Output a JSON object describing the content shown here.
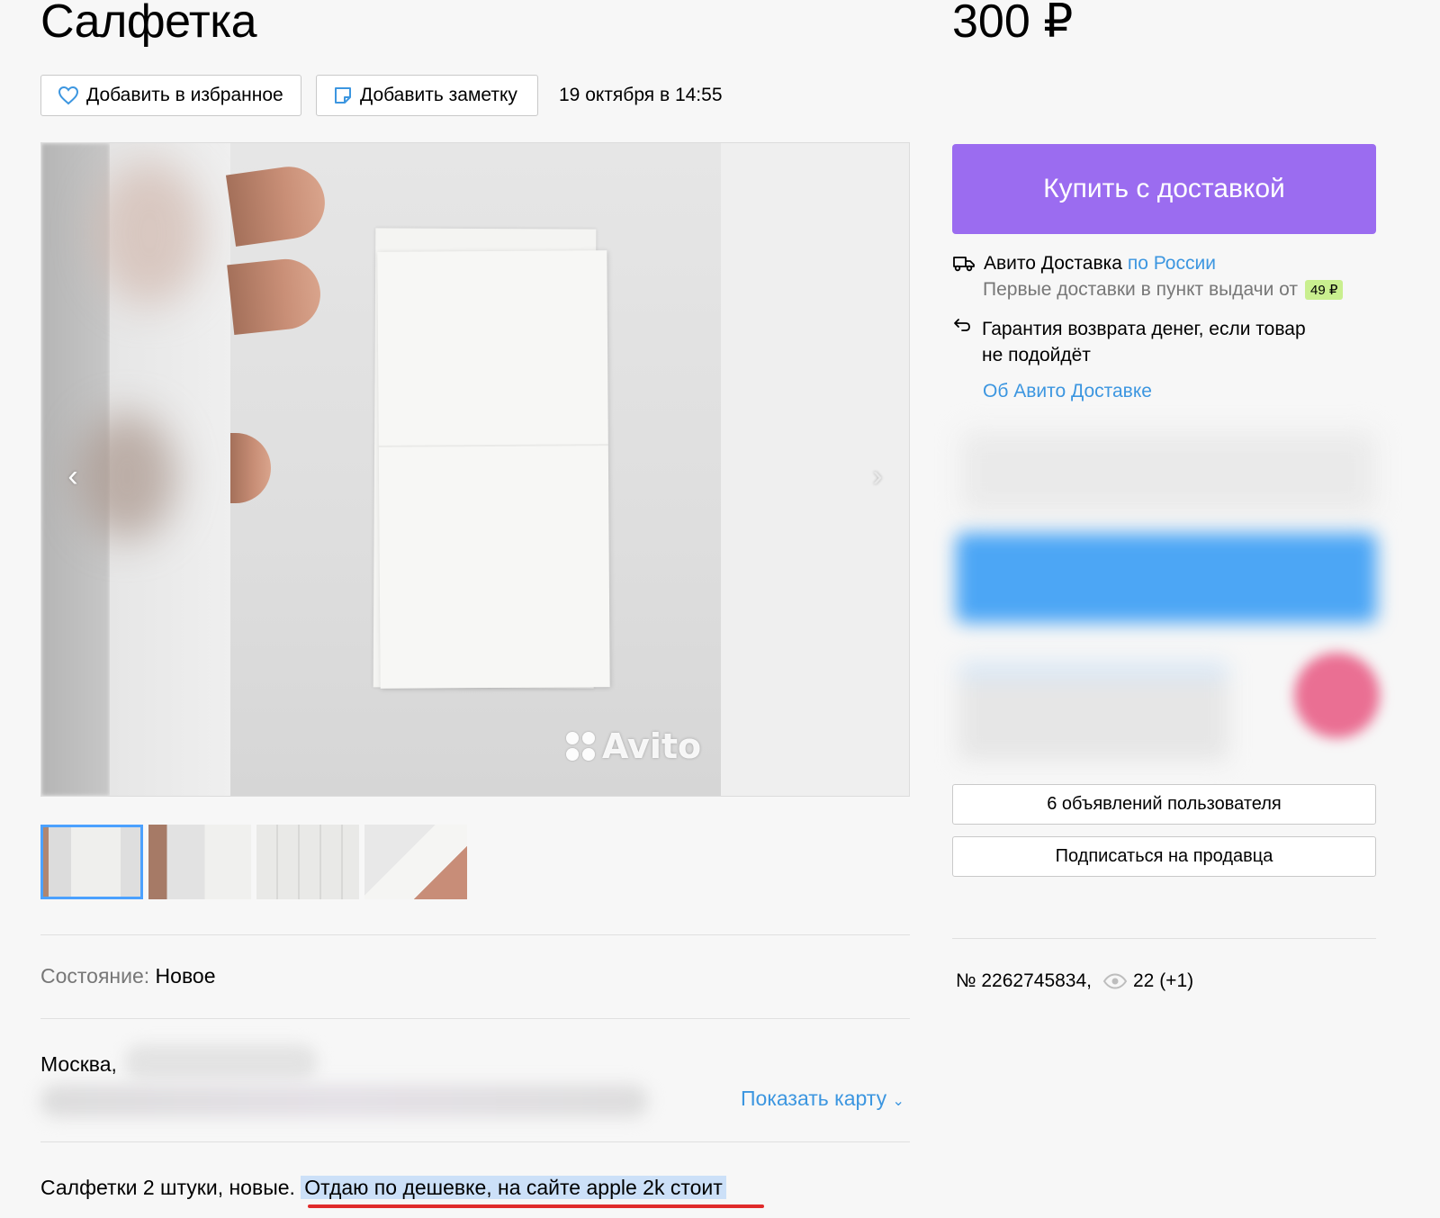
{
  "header": {
    "title": "Салфетка",
    "price": "300 ₽",
    "favorite_label": "Добавить в избранное",
    "note_label": "Добавить заметку",
    "date": "19 октября в 14:55"
  },
  "gallery": {
    "watermark": "Avito",
    "thumbnails_count": 4,
    "active_thumbnail": 1
  },
  "details": {
    "condition_label": "Состояние:",
    "condition_value": "Новое",
    "city": "Москва,",
    "show_map": "Показать карту",
    "description_plain": "Салфетки 2 штуки, новые. ",
    "description_highlight": "Отдаю по дешевке, на сайте apple 2k стоит"
  },
  "sidebar": {
    "buy_button": "Купить с доставкой",
    "delivery_name": "Авито Доставка",
    "delivery_scope": "по России",
    "delivery_sub": "Первые доставки в пункт выдачи от",
    "delivery_price_badge": "49 ₽",
    "guarantee_line1": "Гарантия возврата денег, если товар",
    "guarantee_line2": "не подойдёт",
    "about_delivery": "Об Авито Доставке",
    "ads_button": "6 объявлений пользователя",
    "subscribe_button": "Подписаться на продавца",
    "listing_number": "№ 2262745834,",
    "views": "22 (+1)"
  },
  "colors": {
    "buy_button": "#9b6cf0",
    "link": "#3c96e0",
    "badge": "#c9ef8f",
    "highlight": "#cce0f8",
    "underline": "#e02a2a"
  }
}
